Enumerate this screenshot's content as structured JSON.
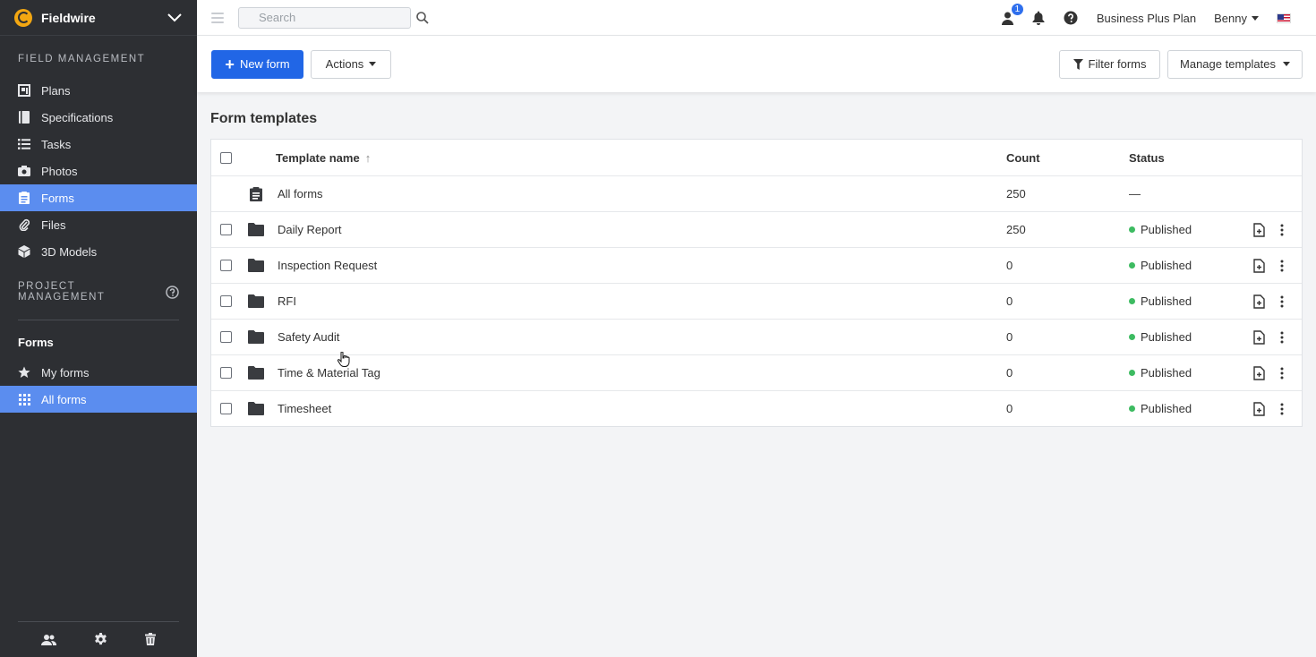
{
  "brand": {
    "name": "Fieldwire",
    "accent": "#f3a712"
  },
  "sidebar": {
    "field_management_label": "FIELD MANAGEMENT",
    "items": [
      {
        "label": "Plans",
        "icon": "plans-icon"
      },
      {
        "label": "Specifications",
        "icon": "specifications-icon"
      },
      {
        "label": "Tasks",
        "icon": "tasks-icon"
      },
      {
        "label": "Photos",
        "icon": "camera-icon"
      },
      {
        "label": "Forms",
        "icon": "forms-icon",
        "active": true
      },
      {
        "label": "Files",
        "icon": "paperclip-icon"
      },
      {
        "label": "3D Models",
        "icon": "cube-icon"
      }
    ],
    "project_management_label": "PROJECT MANAGEMENT",
    "forms_section_title": "Forms",
    "forms_items": [
      {
        "label": "My forms",
        "icon": "star-icon"
      },
      {
        "label": "All forms",
        "icon": "grid-icon",
        "active": true
      }
    ],
    "footer_icons": [
      "people-icon",
      "gear-icon",
      "trash-icon"
    ]
  },
  "topbar": {
    "search_placeholder": "Search",
    "notifications_badge": "1",
    "plan": "Business Plus Plan",
    "user": "Benny"
  },
  "toolbar": {
    "new_form": "New form",
    "actions": "Actions",
    "filter_forms": "Filter forms",
    "manage_templates": "Manage templates"
  },
  "main": {
    "title": "Form templates",
    "columns": {
      "name": "Template name",
      "count": "Count",
      "status": "Status"
    },
    "all_row": {
      "name": "All forms",
      "count": "250",
      "status": "—"
    },
    "rows": [
      {
        "name": "Daily Report",
        "count": "250",
        "status": "Published"
      },
      {
        "name": "Inspection Request",
        "count": "0",
        "status": "Published"
      },
      {
        "name": "RFI",
        "count": "0",
        "status": "Published"
      },
      {
        "name": "Safety Audit",
        "count": "0",
        "status": "Published"
      },
      {
        "name": "Time & Material Tag",
        "count": "0",
        "status": "Published"
      },
      {
        "name": "Timesheet",
        "count": "0",
        "status": "Published"
      }
    ]
  },
  "colors": {
    "sidebar_bg": "#2d2f33",
    "active_nav": "#5b8def",
    "primary": "#2166e6",
    "published": "#3dbb61"
  }
}
